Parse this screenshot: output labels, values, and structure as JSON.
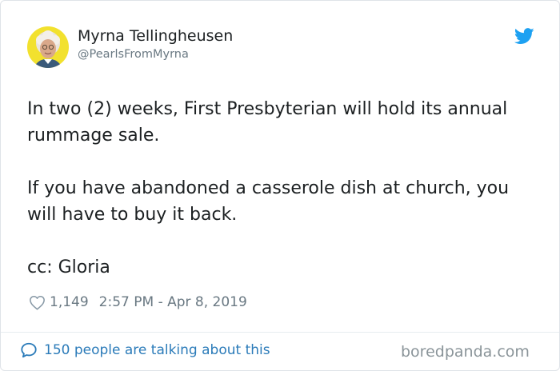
{
  "user": {
    "display_name": "Myrna Tellingheusen",
    "handle": "@PearlsFromMyrna"
  },
  "tweet": {
    "paragraphs": [
      "In two (2) weeks, First Presbyterian will hold its annual rummage sale.",
      "If you have abandoned a casserole dish at church, you will have to buy it back.",
      "cc: Gloria"
    ],
    "likes": "1,149",
    "timestamp": "2:57 PM - Apr 8, 2019"
  },
  "footer": {
    "talking_text": "150 people are talking about this",
    "watermark": "boredpanda.com"
  },
  "icons": {
    "brand": "twitter-bird-icon",
    "like": "heart-icon",
    "reply": "speech-bubble-icon"
  },
  "colors": {
    "twitter_blue": "#1da1f2",
    "link_blue": "#2b7bb9",
    "text": "#1c2022",
    "muted": "#697882",
    "avatar_bg": "#f2e12e"
  }
}
